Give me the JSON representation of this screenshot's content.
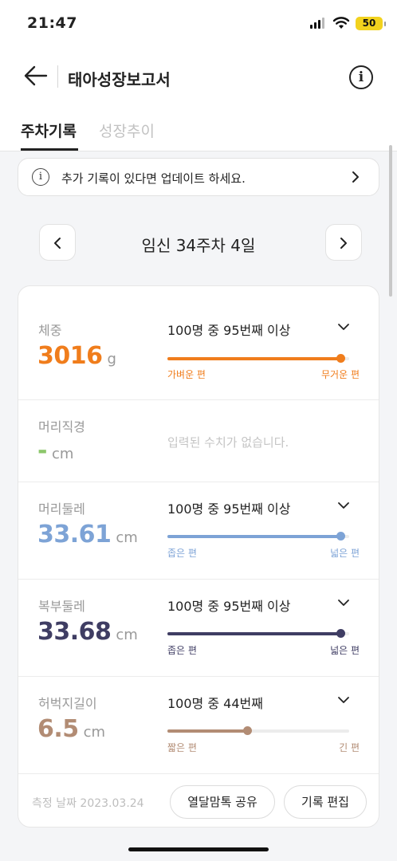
{
  "status_bar": {
    "time": "21:47",
    "battery": "50"
  },
  "header": {
    "title": "태아성장보고서"
  },
  "tabs": [
    {
      "label": "주차기록",
      "active": true
    },
    {
      "label": "성장추이",
      "active": false
    }
  ],
  "notice": {
    "text": "추가 기록이 있다면 업데이트 하세요."
  },
  "week_nav": {
    "label": "임신 34주차 4일"
  },
  "measurements": [
    {
      "label": "체중",
      "value": "3016",
      "unit": "g",
      "rank": "100명 중 95번째 이상",
      "position_pct": 95,
      "low_label": "가벼운 편",
      "high_label": "무거운 편",
      "color": "#f07d1c",
      "track_color": "#f07d1c"
    },
    {
      "label": "머리직경",
      "value": "-",
      "unit": "cm",
      "empty_text": "입력된 수치가 없습니다.",
      "color": "#8cc76b"
    },
    {
      "label": "머리둘레",
      "value": "33.61",
      "unit": "cm",
      "rank": "100명 중 95번째 이상",
      "position_pct": 95,
      "low_label": "좁은 편",
      "high_label": "넓은 편",
      "color": "#7da3d6",
      "track_color": "#7da3d6"
    },
    {
      "label": "복부둘레",
      "value": "33.68",
      "unit": "cm",
      "rank": "100명 중 95번째 이상",
      "position_pct": 95,
      "low_label": "좁은 편",
      "high_label": "넓은 편",
      "color": "#3f3d63",
      "track_color": "#3f3d63"
    },
    {
      "label": "허벅지길이",
      "value": "6.5",
      "unit": "cm",
      "rank": "100명 중 44번째",
      "position_pct": 44,
      "low_label": "짧은 편",
      "high_label": "긴 편",
      "color": "#b28c74",
      "track_color": "#b28c74"
    }
  ],
  "footer": {
    "date": "측정 날짜 2023.03.24",
    "share_label": "열달맘톡 공유",
    "edit_label": "기록 편집"
  },
  "icons": [
    "back-arrow-icon",
    "info-icon",
    "chevron-right-icon",
    "chevron-left-icon",
    "chevron-down-icon",
    "signal-icon",
    "wifi-icon",
    "battery-icon"
  ]
}
